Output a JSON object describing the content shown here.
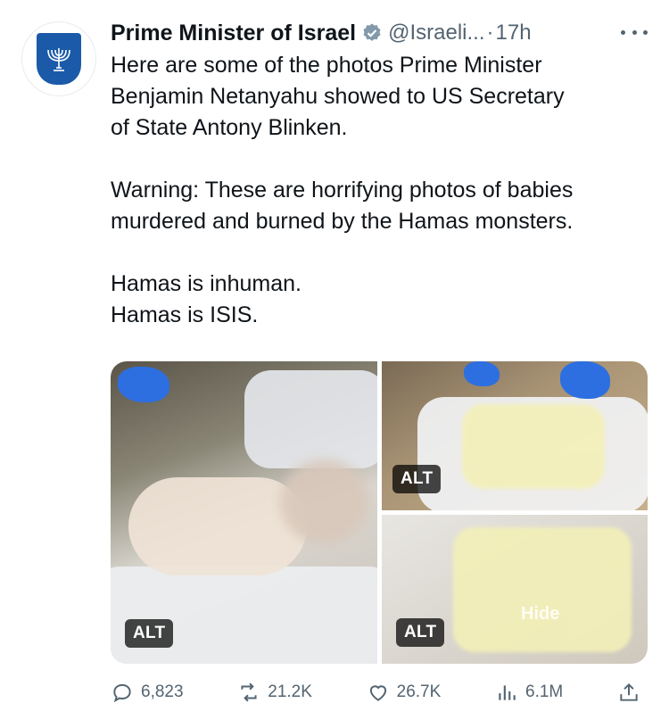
{
  "author": {
    "name": "Prime Minister of Israel",
    "handle": "@Israeli...",
    "separator": "·",
    "time": "17h"
  },
  "tweet": {
    "text": "Here are some of the photos Prime Minister\nBenjamin Netanyahu showed to US Secretary\nof State Antony Blinken.\n\nWarning: These are horrifying photos of babies\nmurdered and burned by the Hamas monsters.\n\nHamas is inhuman.\nHamas is ISIS."
  },
  "media": {
    "alt_label": "ALT",
    "hide_label": "Hide"
  },
  "actions": {
    "replies": "6,823",
    "reposts": "21.2K",
    "likes": "26.7K",
    "views": "6.1M"
  },
  "colors": {
    "text": "#0f1419",
    "muted": "#536471",
    "verified": "#829aab"
  },
  "icons": [
    "emblem-icon",
    "verified-badge-icon",
    "more-icon",
    "reply-icon",
    "repost-icon",
    "like-icon",
    "views-icon",
    "share-icon"
  ]
}
